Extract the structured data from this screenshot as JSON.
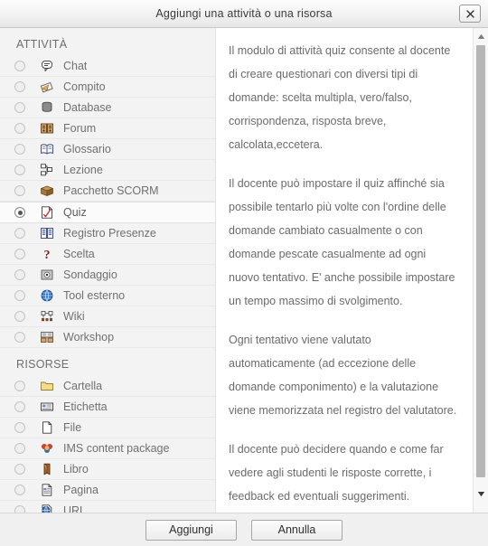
{
  "window": {
    "title": "Aggiungi una attività o una risorsa",
    "close_label": "×"
  },
  "sidebar": {
    "sections": [
      {
        "heading": "ATTIVITÀ",
        "items": [
          {
            "label": "Chat",
            "icon": "chat-icon",
            "selected": false
          },
          {
            "label": "Compito",
            "icon": "assignment-icon",
            "selected": false
          },
          {
            "label": "Database",
            "icon": "database-icon",
            "selected": false
          },
          {
            "label": "Forum",
            "icon": "forum-icon",
            "selected": false
          },
          {
            "label": "Glossario",
            "icon": "glossary-icon",
            "selected": false
          },
          {
            "label": "Lezione",
            "icon": "lesson-icon",
            "selected": false
          },
          {
            "label": "Pacchetto SCORM",
            "icon": "scorm-package-icon",
            "selected": false
          },
          {
            "label": "Quiz",
            "icon": "quiz-icon",
            "selected": true
          },
          {
            "label": "Registro Presenze",
            "icon": "attendance-icon",
            "selected": false
          },
          {
            "label": "Scelta",
            "icon": "choice-icon",
            "selected": false
          },
          {
            "label": "Sondaggio",
            "icon": "survey-icon",
            "selected": false
          },
          {
            "label": "Tool esterno",
            "icon": "external-tool-icon",
            "selected": false
          },
          {
            "label": "Wiki",
            "icon": "wiki-icon",
            "selected": false
          },
          {
            "label": "Workshop",
            "icon": "workshop-icon",
            "selected": false
          }
        ]
      },
      {
        "heading": "RISORSE",
        "items": [
          {
            "label": "Cartella",
            "icon": "folder-icon",
            "selected": false
          },
          {
            "label": "Etichetta",
            "icon": "label-icon",
            "selected": false
          },
          {
            "label": "File",
            "icon": "file-icon",
            "selected": false
          },
          {
            "label": "IMS content package",
            "icon": "ims-package-icon",
            "selected": false
          },
          {
            "label": "Libro",
            "icon": "book-icon",
            "selected": false
          },
          {
            "label": "Pagina",
            "icon": "page-icon",
            "selected": false
          },
          {
            "label": "URL",
            "icon": "url-icon",
            "selected": false
          }
        ]
      }
    ]
  },
  "description": {
    "paragraphs": [
      "Il modulo di attività quiz consente al docente di creare questionari con diversi tipi di domande: scelta multipla, vero/falso, corrispondenza, risposta breve, calcolata,eccetera.",
      "Il docente può impostare il quiz affinché sia possibile tentarlo più volte con l'ordine delle domande cambiato casualmente o con domande pescate casualmente ad ogni nuovo tentativo. E' anche possibile impostare un tempo massimo di svolgimento.",
      "Ogni tentativo viene valutato automaticamente (ad eccezione delle domande componimento) e la valutazione viene memorizzata nel registro del valutatore.",
      "Il docente può decidere quando e come far vedere agli studenti le risposte corrette, i feedback ed eventuali suggerimenti."
    ]
  },
  "scrollbar": {
    "up_arrow": "scroll-up",
    "down_arrow": "scroll-down"
  },
  "footer": {
    "submit_label": "Aggiungi",
    "cancel_label": "Annulla"
  },
  "colors": {
    "panel_bg": "#f3f3f3",
    "text": "#6b6b6b",
    "titlebar": "#f2f2f2"
  }
}
